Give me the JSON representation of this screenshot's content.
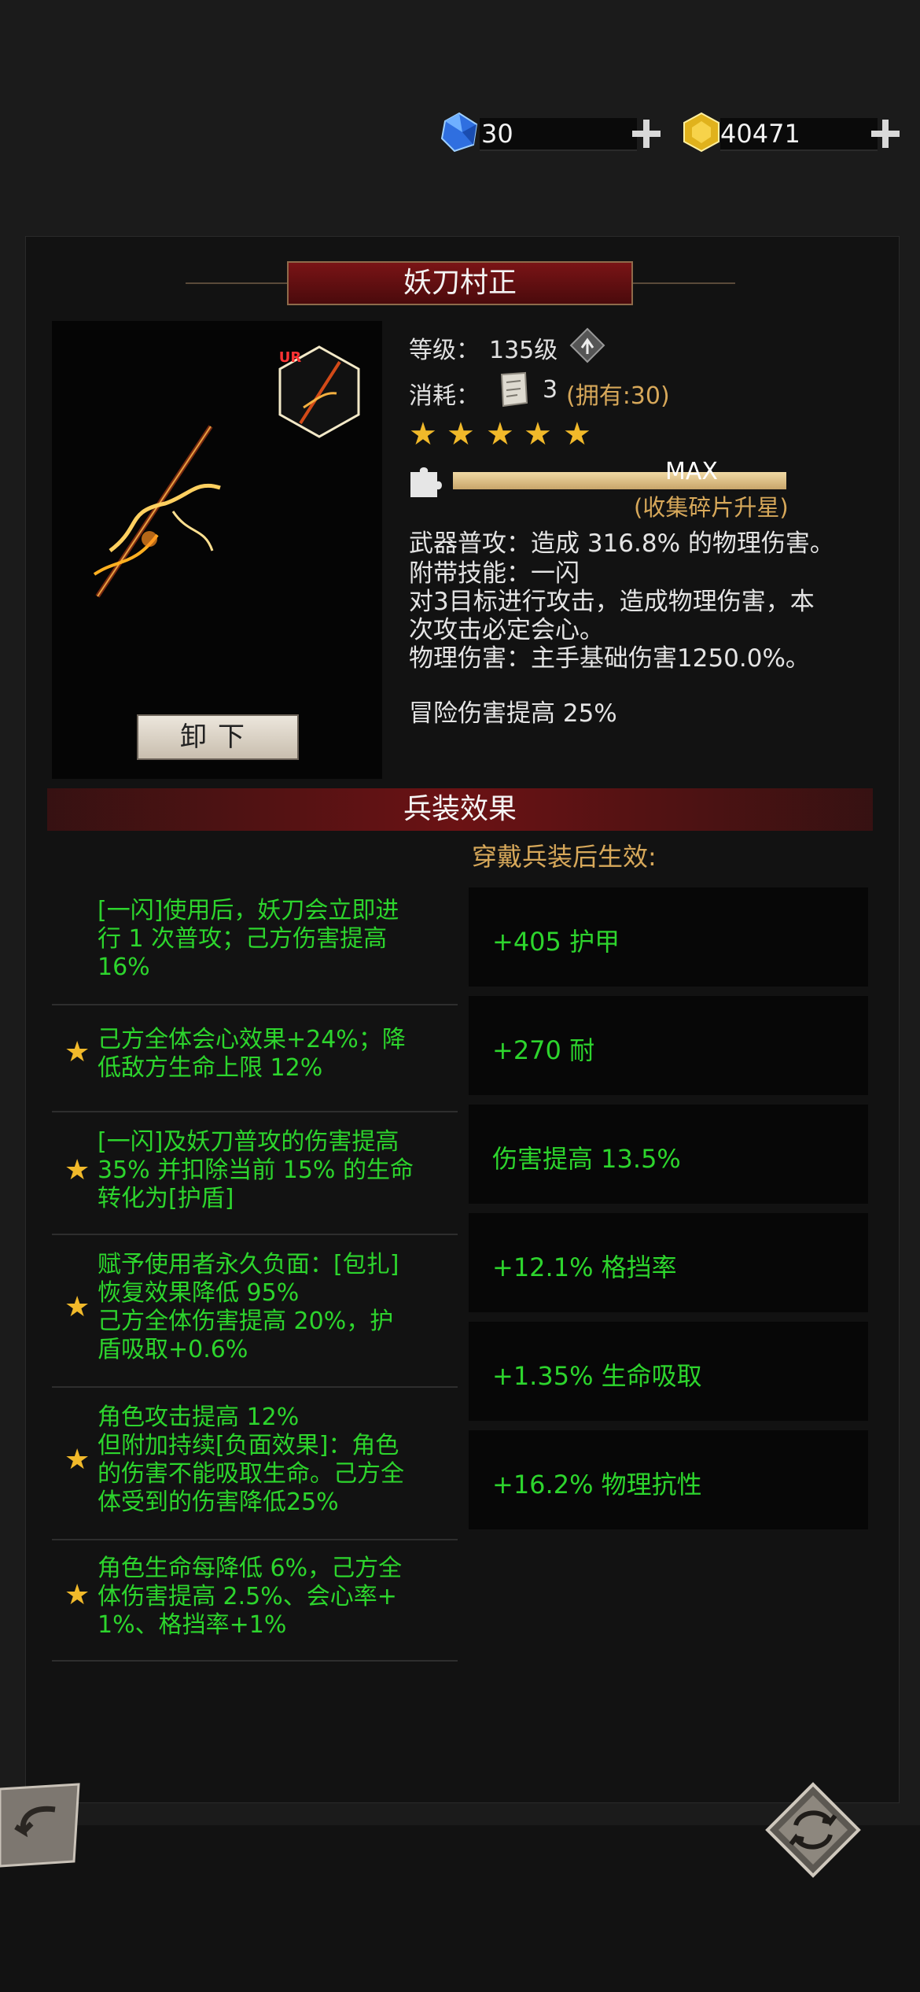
{
  "currency": {
    "gems": "30",
    "gold": "40471"
  },
  "item": {
    "name": "妖刀村正",
    "level_label": "等级：",
    "level_value": "135级",
    "cost_label": "消耗：",
    "cost_qty": "3",
    "cost_owned": "(拥有:30)",
    "stars": 5,
    "progress_text": "MAX",
    "progress_fraction": 1.0,
    "progress_hint": "(收集碎片升星)",
    "rarity": "UR",
    "desc_lines": [
      "武器普攻：造成 316.8% 的物理伤害。",
      "附带技能：一闪",
      "对3目标进行攻击，造成物理伤害，本",
      "次攻击必定会心。",
      "物理伤害：主手基础伤害1250.0%。"
    ],
    "bonus": "冒险伤害提高 25%",
    "unequip_label": "卸下"
  },
  "effects": {
    "title": "兵装效果",
    "subtitle": "穿戴兵装后生效:",
    "left": [
      {
        "lines": [
          "[一闪]使用后，妖刀会立即进",
          "行 1 次普攻；己方伤害提高",
          "16%"
        ],
        "star": false
      },
      {
        "lines": [
          "己方全体会心效果+24%；降",
          "低敌方生命上限 12%"
        ],
        "star": true
      },
      {
        "lines": [
          "[一闪]及妖刀普攻的伤害提高",
          "35% 并扣除当前 15% 的生命",
          "转化为[护盾]"
        ],
        "star": true
      },
      {
        "lines": [
          "赋予使用者永久负面：[包扎]",
          "恢复效果降低 95%",
          "己方全体伤害提高 20%，护",
          "盾吸取+0.6%"
        ],
        "star": true
      },
      {
        "lines": [
          "角色攻击提高 12%",
          "但附加持续[负面效果]：角色",
          "的伤害不能吸取生命。己方全",
          "体受到的伤害降低25%"
        ],
        "star": true
      },
      {
        "lines": [
          "角色生命每降低 6%，己方全",
          "体伤害提高 2.5%、会心率+",
          "1%、格挡率+1%"
        ],
        "star": true
      }
    ],
    "stats": [
      "+405 护甲",
      "+270 耐",
      "伤害提高 13.5%",
      "+12.1% 格挡率",
      "+1.35% 生命吸取",
      "+16.2% 物理抗性"
    ]
  }
}
